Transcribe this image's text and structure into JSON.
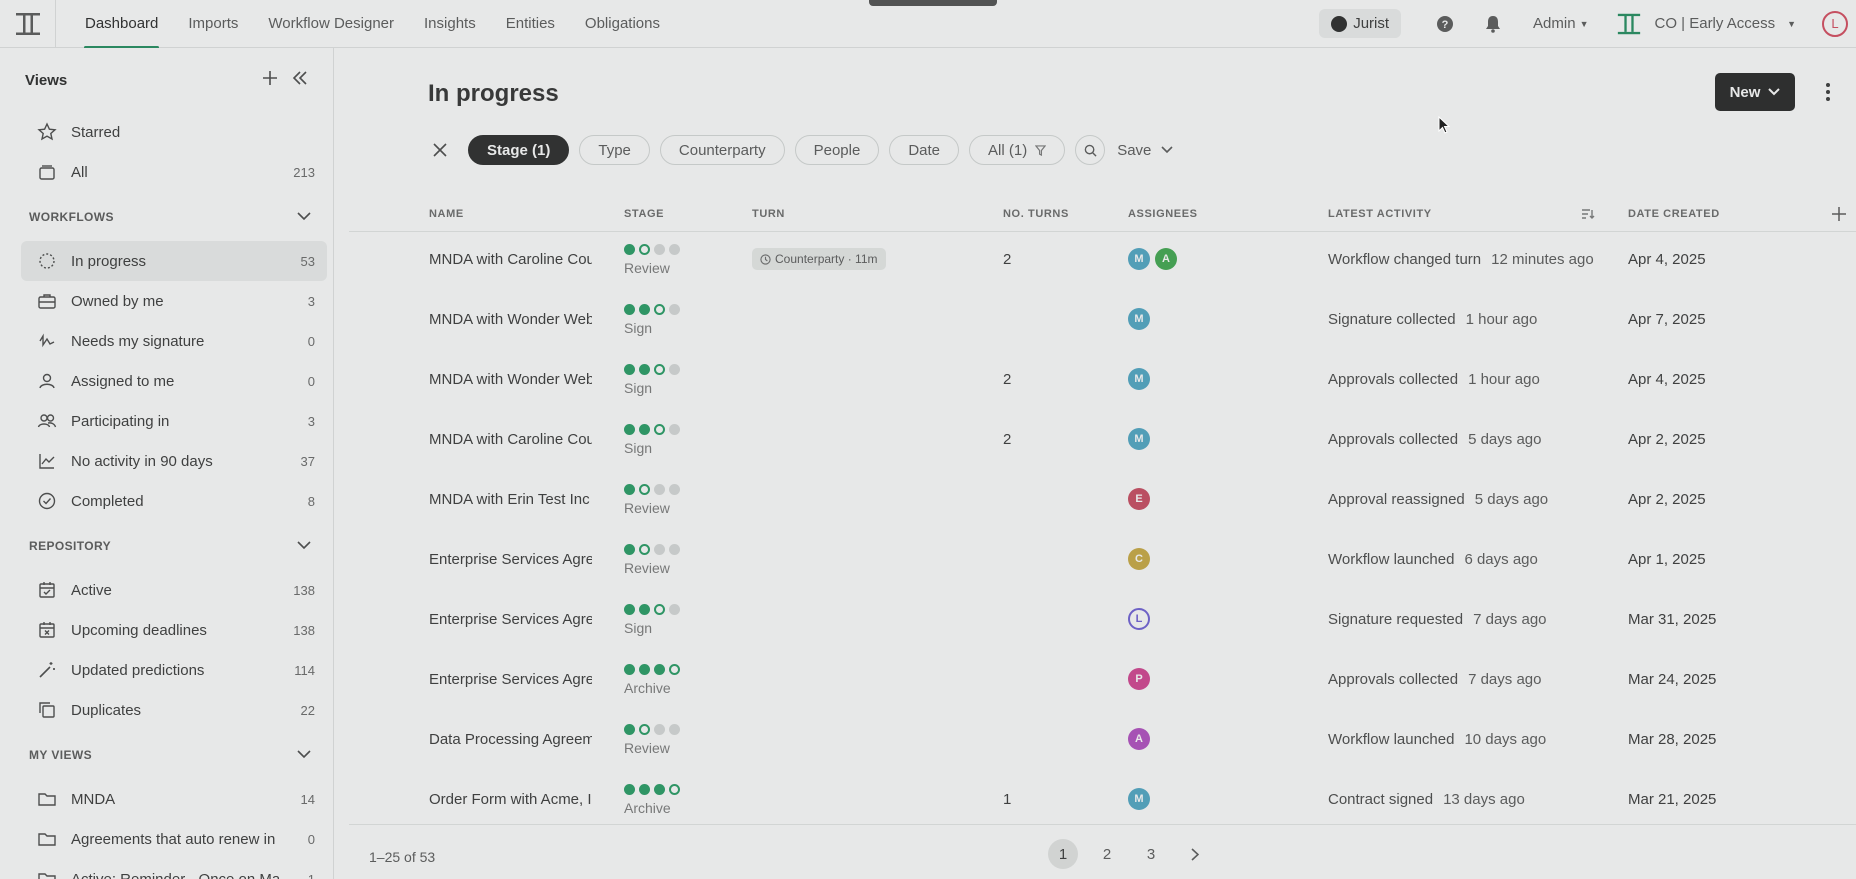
{
  "nav": {
    "links": [
      "Dashboard",
      "Imports",
      "Workflow Designer",
      "Insights",
      "Entities",
      "Obligations"
    ],
    "jurist_label": "Jurist",
    "admin_label": "Admin",
    "org_label": "CO | Early Access",
    "user_initial": "L"
  },
  "sidebar": {
    "title": "Views",
    "top_items": [
      {
        "label": "Starred",
        "count": "",
        "icon": "star-icon"
      },
      {
        "label": "All",
        "count": "213",
        "icon": "folder-stack-icon"
      }
    ],
    "sections": [
      {
        "title": "WORKFLOWS",
        "items": [
          {
            "label": "In progress",
            "count": "53",
            "icon": "dashed-circle-icon",
            "selected": true
          },
          {
            "label": "Owned by me",
            "count": "3",
            "icon": "briefcase-icon"
          },
          {
            "label": "Needs my signature",
            "count": "0",
            "icon": "signature-icon"
          },
          {
            "label": "Assigned to me",
            "count": "0",
            "icon": "person-icon"
          },
          {
            "label": "Participating in",
            "count": "3",
            "icon": "people-icon"
          },
          {
            "label": "No activity in 90 days",
            "count": "37",
            "icon": "chart-line-icon"
          },
          {
            "label": "Completed",
            "count": "8",
            "icon": "check-circle-icon"
          }
        ]
      },
      {
        "title": "REPOSITORY",
        "items": [
          {
            "label": "Active",
            "count": "138",
            "icon": "calendar-check-icon"
          },
          {
            "label": "Upcoming deadlines",
            "count": "138",
            "icon": "calendar-x-icon"
          },
          {
            "label": "Updated predictions",
            "count": "114",
            "icon": "magic-wand-icon"
          },
          {
            "label": "Duplicates",
            "count": "22",
            "icon": "copy-icon"
          }
        ]
      },
      {
        "title": "MY VIEWS",
        "items": [
          {
            "label": "MNDA",
            "count": "14",
            "icon": "folder-icon"
          },
          {
            "label": "Agreements that auto renew in",
            "count": "0",
            "icon": "folder-icon"
          },
          {
            "label": "Active: Reminder - Once on Ma",
            "count": "1",
            "icon": "folder-icon"
          }
        ]
      }
    ]
  },
  "main": {
    "title": "In progress",
    "new_button": "New",
    "filters": [
      "Stage (1)",
      "Type",
      "Counterparty",
      "People",
      "Date",
      "All (1)"
    ],
    "save_label": "Save",
    "columns": [
      "NAME",
      "STAGE",
      "TURN",
      "NO. TURNS",
      "ASSIGNEES",
      "LATEST ACTIVITY",
      "DATE CREATED"
    ],
    "rows": [
      {
        "name": "MNDA with Caroline Cou",
        "stage": "Review",
        "dots": [
          "f",
          "o",
          "e",
          "e"
        ],
        "turn": "Counterparty · 11m",
        "turns": "2",
        "assignees": [
          {
            "i": "M",
            "c": "#4aa5c4"
          },
          {
            "i": "A",
            "c": "#3aa64a"
          }
        ],
        "activity": "Workflow changed turn",
        "ago": "12 minutes ago",
        "created": "Apr 4, 2025"
      },
      {
        "name": "MNDA with Wonder Web,",
        "stage": "Sign",
        "dots": [
          "f",
          "f",
          "o",
          "e"
        ],
        "turn": "",
        "turns": "",
        "assignees": [
          {
            "i": "M",
            "c": "#4aa5c4"
          }
        ],
        "activity": "Signature collected",
        "ago": "1 hour ago",
        "created": "Apr 7, 2025"
      },
      {
        "name": "MNDA with Wonder Web,",
        "stage": "Sign",
        "dots": [
          "f",
          "f",
          "o",
          "e"
        ],
        "turn": "",
        "turns": "2",
        "assignees": [
          {
            "i": "M",
            "c": "#4aa5c4"
          }
        ],
        "activity": "Approvals collected",
        "ago": "1 hour ago",
        "created": "Apr 4, 2025"
      },
      {
        "name": "MNDA with Caroline Cou",
        "stage": "Sign",
        "dots": [
          "f",
          "f",
          "o",
          "e"
        ],
        "turn": "",
        "turns": "2",
        "assignees": [
          {
            "i": "M",
            "c": "#4aa5c4"
          }
        ],
        "activity": "Approvals collected",
        "ago": "5 days ago",
        "created": "Apr 2, 2025"
      },
      {
        "name": "MNDA with Erin Test Inc",
        "stage": "Review",
        "dots": [
          "f",
          "o",
          "e",
          "e"
        ],
        "turn": "",
        "turns": "",
        "assignees": [
          {
            "i": "E",
            "c": "#c9455c"
          }
        ],
        "activity": "Approval reassigned",
        "ago": "5 days ago",
        "created": "Apr 2, 2025"
      },
      {
        "name": "Enterprise Services Agre",
        "stage": "Review",
        "dots": [
          "f",
          "o",
          "e",
          "e"
        ],
        "turn": "",
        "turns": "",
        "assignees": [
          {
            "i": "C",
            "c": "#c9a83c"
          }
        ],
        "activity": "Workflow launched",
        "ago": "6 days ago",
        "created": "Apr 1, 2025"
      },
      {
        "name": "Enterprise Services Agre",
        "stage": "Sign",
        "dots": [
          "f",
          "f",
          "o",
          "e"
        ],
        "turn": "",
        "turns": "",
        "assignees": [
          {
            "i": "L",
            "c": "outline"
          }
        ],
        "activity": "Signature requested",
        "ago": "7 days ago",
        "created": "Mar 31, 2025"
      },
      {
        "name": "Enterprise Services Agre",
        "stage": "Archive",
        "dots": [
          "f",
          "f",
          "f",
          "o"
        ],
        "turn": "",
        "turns": "",
        "assignees": [
          {
            "i": "P",
            "c": "#d23d8e"
          }
        ],
        "activity": "Approvals collected",
        "ago": "7 days ago",
        "created": "Mar 24, 2025"
      },
      {
        "name": "Data Processing Agreem",
        "stage": "Review",
        "dots": [
          "f",
          "o",
          "e",
          "e"
        ],
        "turn": "",
        "turns": "",
        "assignees": [
          {
            "i": "A",
            "c": "#b048c0"
          }
        ],
        "activity": "Workflow launched",
        "ago": "10 days ago",
        "created": "Mar 28, 2025"
      },
      {
        "name": "Order Form with Acme, Ir",
        "stage": "Archive",
        "dots": [
          "f",
          "f",
          "f",
          "o"
        ],
        "turn": "",
        "turns": "1",
        "assignees": [
          {
            "i": "M",
            "c": "#4aa5c4"
          }
        ],
        "activity": "Contract signed",
        "ago": "13 days ago",
        "created": "Mar 21, 2025"
      }
    ],
    "range_text": "1–25 of 53",
    "pages": [
      "1",
      "2",
      "3"
    ]
  }
}
